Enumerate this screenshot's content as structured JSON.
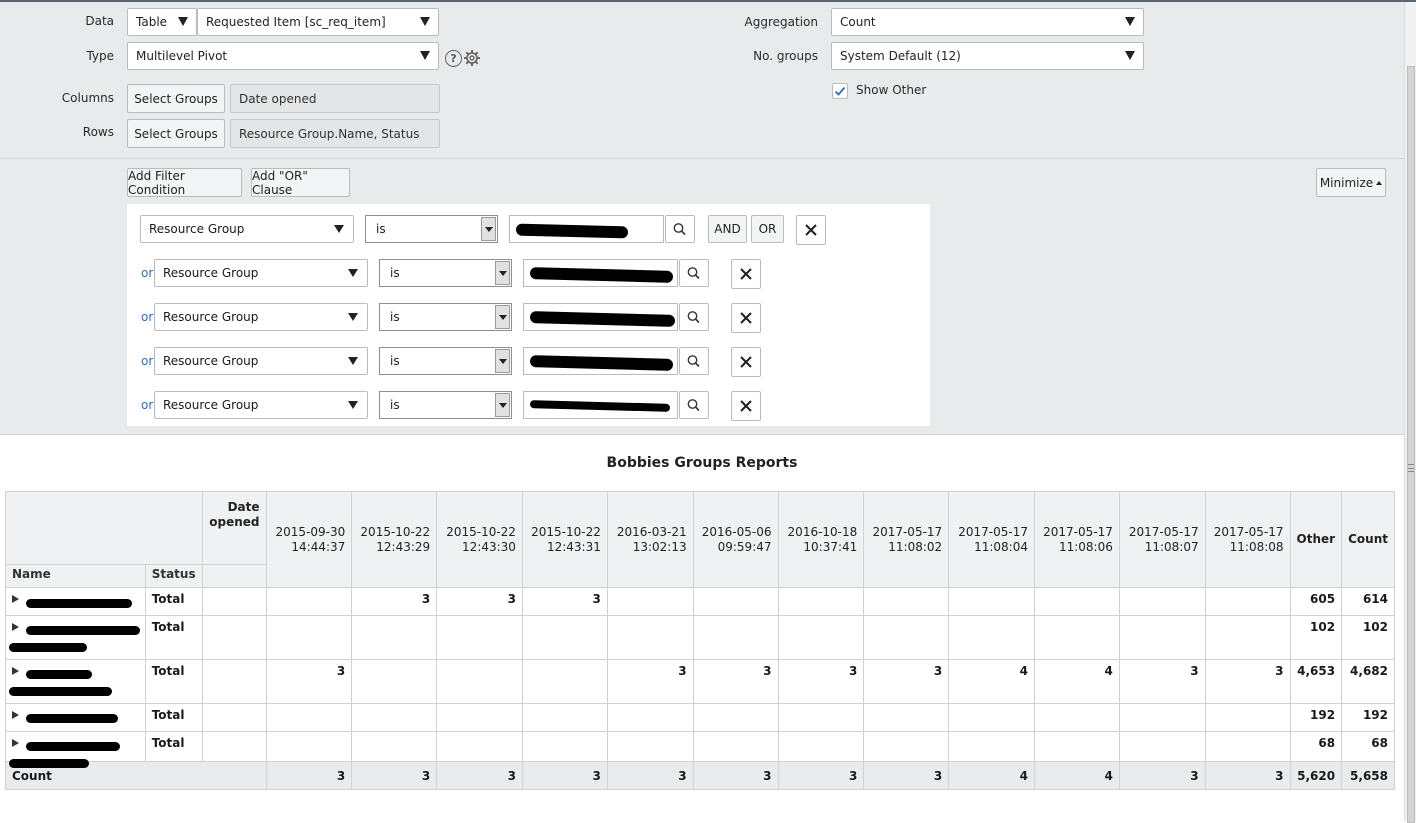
{
  "config": {
    "data_label": "Data",
    "data_source": "Table",
    "data_table": "Requested Item [sc_req_item]",
    "type_label": "Type",
    "type_value": "Multilevel Pivot",
    "columns_label": "Columns",
    "columns_button": "Select Groups",
    "columns_value": "Date opened",
    "rows_label": "Rows",
    "rows_button": "Select Groups",
    "rows_value": "Resource Group.Name, Status",
    "aggregation_label": "Aggregation",
    "aggregation_value": "Count",
    "groups_label": "No. groups",
    "groups_value": "System Default (12)",
    "show_other_label": "Show Other",
    "show_other_checked": true
  },
  "filter": {
    "add_condition": "Add Filter Condition",
    "add_or": "Add \"OR\" Clause",
    "minimize": "Minimize",
    "and_label": "AND",
    "or_button_label": "OR",
    "or_prefix": "or",
    "conditions": [
      {
        "field": "Resource Group",
        "operator": "is"
      },
      {
        "field": "Resource Group",
        "operator": "is"
      },
      {
        "field": "Resource Group",
        "operator": "is"
      },
      {
        "field": "Resource Group",
        "operator": "is"
      },
      {
        "field": "Resource Group",
        "operator": "is"
      }
    ]
  },
  "report": {
    "title": "Bobbies Groups Reports",
    "header_name": "Name",
    "header_status": "Status",
    "header_date": "Date opened",
    "dates": [
      {
        "d": "2015-09-30",
        "t": "14:44:37"
      },
      {
        "d": "2015-10-22",
        "t": "12:43:29"
      },
      {
        "d": "2015-10-22",
        "t": "12:43:30"
      },
      {
        "d": "2015-10-22",
        "t": "12:43:31"
      },
      {
        "d": "2016-03-21",
        "t": "13:02:13"
      },
      {
        "d": "2016-05-06",
        "t": "09:59:47"
      },
      {
        "d": "2016-10-18",
        "t": "10:37:41"
      },
      {
        "d": "2017-05-17",
        "t": "11:08:02"
      },
      {
        "d": "2017-05-17",
        "t": "11:08:04"
      },
      {
        "d": "2017-05-17",
        "t": "11:08:06"
      },
      {
        "d": "2017-05-17",
        "t": "11:08:07"
      },
      {
        "d": "2017-05-17",
        "t": "11:08:08"
      }
    ],
    "header_other": "Other",
    "header_count": "Count",
    "rows": [
      {
        "status": "Total",
        "cells": [
          "",
          "3",
          "3",
          "3",
          "",
          "",
          "",
          "",
          "",
          "",
          "",
          ""
        ],
        "other": "605",
        "count": "614"
      },
      {
        "status": "Total",
        "cells": [
          "",
          "",
          "",
          "",
          "",
          "",
          "",
          "",
          "",
          "",
          "",
          ""
        ],
        "other": "102",
        "count": "102"
      },
      {
        "status": "Total",
        "cells": [
          "3",
          "",
          "",
          "",
          "3",
          "3",
          "3",
          "3",
          "4",
          "4",
          "3",
          "3"
        ],
        "other": "4,653",
        "count": "4,682"
      },
      {
        "status": "Total",
        "cells": [
          "",
          "",
          "",
          "",
          "",
          "",
          "",
          "",
          "",
          "",
          "",
          ""
        ],
        "other": "192",
        "count": "192"
      },
      {
        "status": "Total",
        "cells": [
          "",
          "",
          "",
          "",
          "",
          "",
          "",
          "",
          "",
          "",
          "",
          ""
        ],
        "other": "68",
        "count": "68"
      }
    ],
    "footer_label": "Count",
    "footer_cells": [
      "3",
      "3",
      "3",
      "3",
      "3",
      "3",
      "3",
      "3",
      "4",
      "4",
      "3",
      "3"
    ],
    "footer_other": "5,620",
    "footer_count": "5,658"
  }
}
